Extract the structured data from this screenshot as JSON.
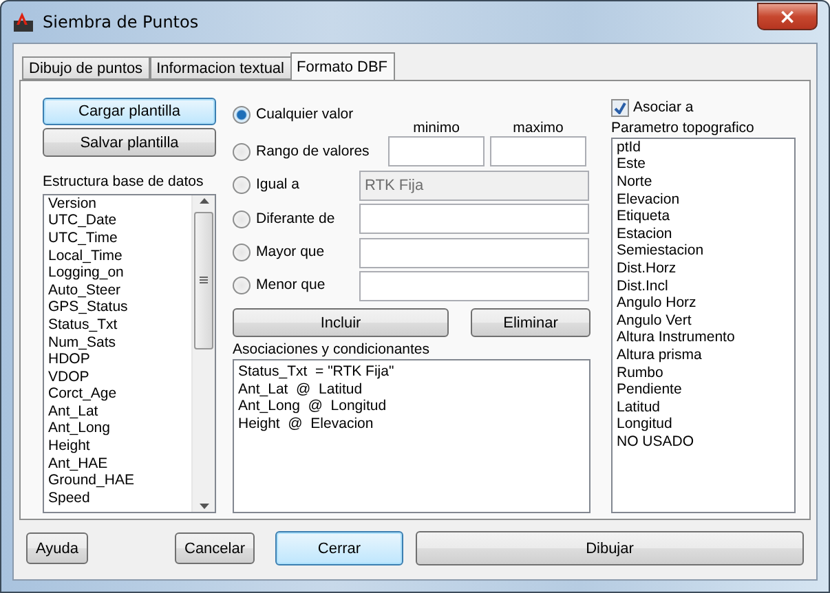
{
  "window": {
    "title": "Siembra de Puntos",
    "close": "×"
  },
  "tabs": [
    {
      "label": "Dibujo de puntos",
      "selected": false
    },
    {
      "label": "Informacion textual",
      "selected": false
    },
    {
      "label": "Formato DBF",
      "selected": true
    }
  ],
  "template_buttons": [
    {
      "label": "Cargar plantilla",
      "focused": true
    },
    {
      "label": "Salvar plantilla",
      "focused": false
    }
  ],
  "database_structure": {
    "label": "Estructura base de datos",
    "items": [
      "Version",
      "UTC_Date",
      "UTC_Time",
      "Local_Time",
      "Logging_on",
      "Auto_Steer",
      "GPS_Status",
      "Status_Txt",
      "Num_Sats",
      "HDOP",
      "VDOP",
      "Corct_Age",
      "Ant_Lat",
      "Ant_Long",
      "Height",
      "Ant_HAE",
      "Ground_HAE",
      "Speed"
    ]
  },
  "conditions": [
    {
      "label": "Cualquier valor",
      "selected": true
    },
    {
      "label": "Rango de valores",
      "selected": false,
      "fields": [
        {
          "label": "minimo",
          "disabled": false
        },
        {
          "label": "maximo",
          "disabled": false
        }
      ]
    },
    {
      "label": "Igual a",
      "selected": false,
      "fields": [
        {
          "value": "RTK Fija",
          "disabled": true
        }
      ]
    },
    {
      "label": "Diferante de",
      "selected": false,
      "fields": [
        {
          "disabled": false
        }
      ]
    },
    {
      "label": "Mayor que",
      "selected": false,
      "fields": [
        {
          "disabled": false
        }
      ]
    },
    {
      "label": "Menor que",
      "selected": false,
      "fields": [
        {
          "disabled": false
        }
      ]
    }
  ],
  "actions": [
    {
      "label": "Incluir"
    },
    {
      "label": "Eliminar"
    }
  ],
  "associations": {
    "label": "Asociaciones y condicionantes",
    "lines": [
      "Status_Txt  = \"RTK Fija\"",
      "Ant_Lat  @  Latitud",
      "Ant_Long  @  Longitud",
      "Height  @  Elevacion"
    ]
  },
  "associate": {
    "label": "Asociar a",
    "checked": true
  },
  "parameters": {
    "label": "Parametro topografico",
    "items": [
      "ptId",
      "Este",
      "Norte",
      "Elevacion",
      "Etiqueta",
      "Estacion",
      "Semiestacion",
      "Dist.Horz",
      "Dist.Incl",
      "Angulo Horz",
      "Angulo Vert",
      "Altura Instrumento",
      "Altura prisma",
      "Rumbo",
      "Pendiente",
      "Latitud",
      "Longitud",
      "NO USADO"
    ]
  },
  "footer_buttons": [
    {
      "label": "Ayuda",
      "focused": false
    },
    {
      "label": "Cancelar",
      "focused": false
    },
    {
      "label": "Cerrar",
      "focused": true
    },
    {
      "label": "Dibujar",
      "focused": false
    }
  ]
}
